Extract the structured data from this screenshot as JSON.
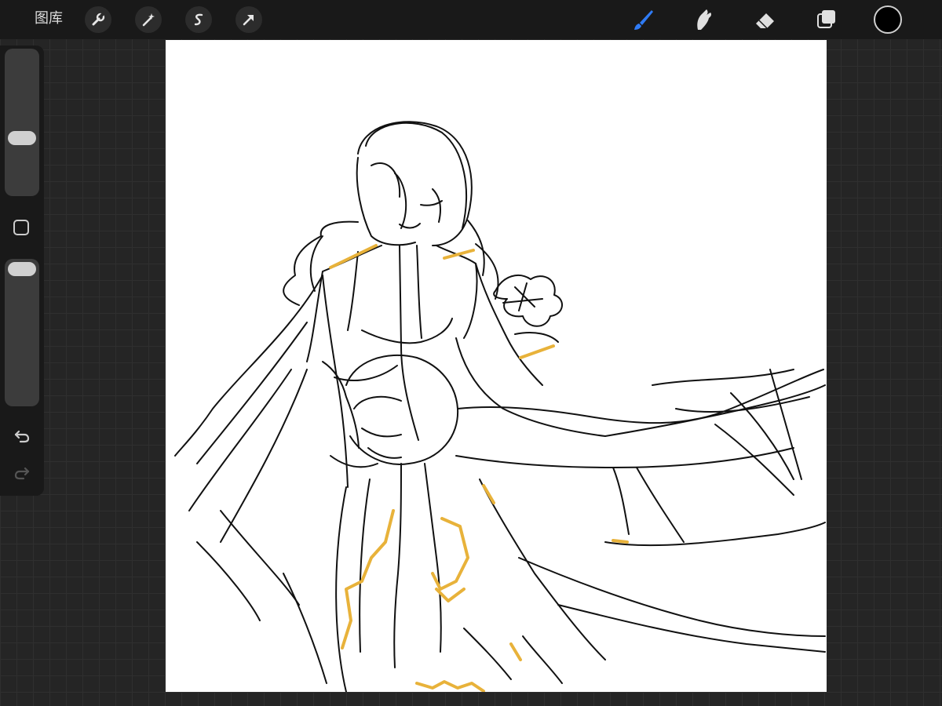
{
  "toolbar": {
    "gallery_label": "图库",
    "left_tools": [
      "wrench-icon",
      "magic-wand-icon",
      "selection-icon",
      "transform-arrow-icon"
    ],
    "right_tools": [
      "brush-icon",
      "smudge-icon",
      "eraser-icon",
      "layers-icon"
    ],
    "active_tool": "brush",
    "active_color": "#000000",
    "accent_color": "#2f7bf5"
  },
  "sidebar": {
    "brush_size_level": 0.59,
    "opacity_level": 1.0,
    "buttons": [
      "modify-button",
      "undo-icon",
      "redo-icon"
    ]
  },
  "canvas": {
    "background": "#ffffff",
    "line_color": "#111111",
    "highlight_color": "#e8b23a"
  }
}
